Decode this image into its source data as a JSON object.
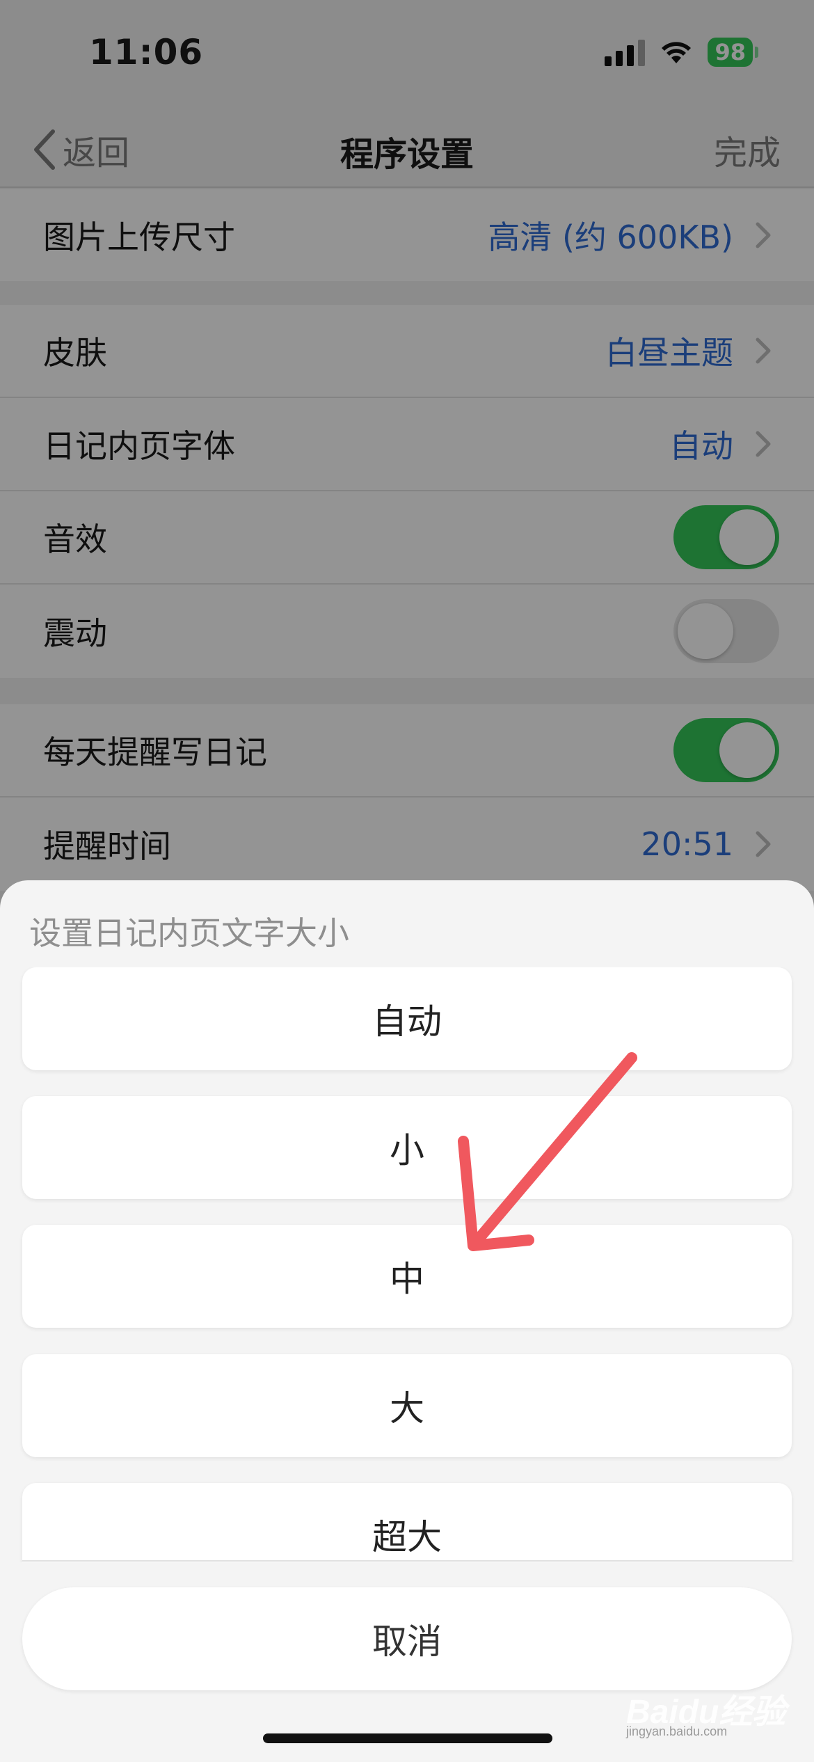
{
  "status_bar": {
    "time": "11:06",
    "battery": "98"
  },
  "nav": {
    "back_label": "返回",
    "title": "程序设置",
    "done_label": "完成"
  },
  "settings": {
    "upload": {
      "label": "图片上传尺寸",
      "value": "高清 (约 600KB)"
    },
    "skin": {
      "label": "皮肤",
      "value": "白昼主题"
    },
    "font": {
      "label": "日记内页字体",
      "value": "自动"
    },
    "sound": {
      "label": "音效",
      "enabled": true
    },
    "vibration": {
      "label": "震动",
      "enabled": false
    },
    "reminder": {
      "label": "每天提醒写日记",
      "enabled": true
    },
    "reminder_time": {
      "label": "提醒时间",
      "value": "20:51"
    }
  },
  "sheet": {
    "title": "设置日记内页文字大小",
    "options": [
      "自动",
      "小",
      "中",
      "大",
      "超大"
    ],
    "cancel_label": "取消"
  },
  "annotation": {
    "arrow_color": "#f0585e",
    "points_to": "中"
  },
  "watermark": {
    "logo": "Baidu经验",
    "sub": "jingyan.baidu.com"
  },
  "colors": {
    "accent_blue": "#2f6bd3",
    "toggle_on": "#34c759",
    "battery": "#34c759"
  }
}
